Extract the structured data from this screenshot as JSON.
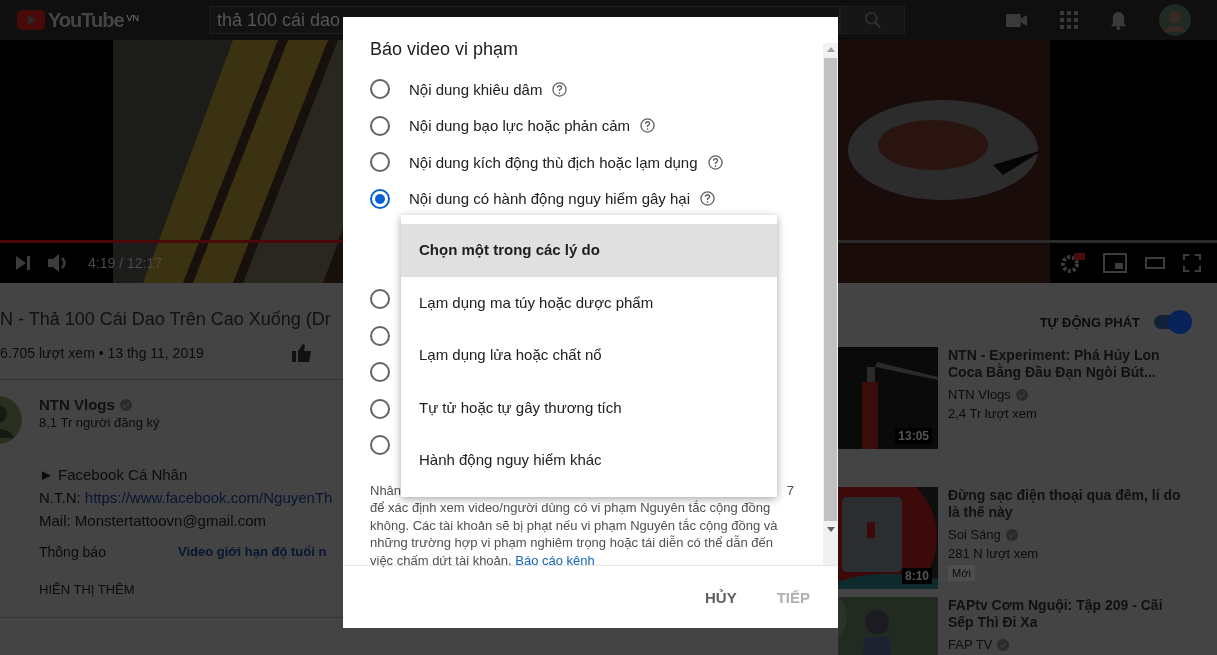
{
  "topbar": {
    "logo": "YouTube",
    "region": "VN",
    "search": {
      "value": "thả 100 cái dao"
    }
  },
  "player": {
    "time": "4:19 / 12:17",
    "progress": {
      "level": 0.35
    }
  },
  "video": {
    "title": "N - Thả 100 Cái Dao Trên Cao Xuống (Dr",
    "meta": "6.705 lượt xem • 13 thg 11, 2019"
  },
  "channel": {
    "name": "NTN Vlogs",
    "verified": true,
    "subscribers": "8,1 Tr người đăng ký"
  },
  "description": {
    "lines": [
      {
        "text": "► Facebook Cá Nhân"
      },
      {
        "text": "N.T.N: ",
        "link": "https://www.facebook.com/NguyenTh"
      },
      {
        "text": "Mail: Monstertattoovn@gmail.com"
      }
    ],
    "category": {
      "label": "Thông báo",
      "value": "Video giới hạn độ tuổi n"
    },
    "show_more": "HIỂN THỊ THÊM"
  },
  "autoplay": {
    "label": "TỰ ĐỘNG PHÁT",
    "on": true
  },
  "up_next": [
    {
      "title": "NTN - Experiment: Phá Hủy Lon Coca Bằng Đầu Đạn Ngòi Bút...",
      "channel": "NTN Vlogs",
      "verified": true,
      "views": "2,4 Tr lượt xem",
      "duration": "13:05"
    },
    {
      "title": "Đừng sạc điện thoại qua đêm, lí do là thế này",
      "channel": "Soi Sáng",
      "verified": true,
      "views": "281 N lượt xem",
      "badge": "Mới",
      "duration": "8:10"
    },
    {
      "title": "FAPtv Cơm Nguội: Tập 209 - Cãi Sếp Thì Đi Xa",
      "channel": "FAP TV",
      "verified": true
    }
  ],
  "dialog": {
    "title": "Báo video vi phạm",
    "options": [
      {
        "label": "Nội dung khiêu dâm",
        "selected": false
      },
      {
        "label": "Nội dung bạo lực hoặc phản cảm",
        "selected": false
      },
      {
        "label": "Nội dung kích động thù địch hoặc lạm dụng",
        "selected": false
      },
      {
        "label": "Nội dung có hành động nguy hiểm gây hại",
        "selected": true
      },
      {
        "selected": false
      },
      {
        "selected": false
      },
      {
        "selected": false
      },
      {
        "selected": false
      },
      {
        "selected": false
      }
    ],
    "reason_menu": {
      "items": [
        {
          "label": "Chọn một trong các lý do",
          "selected": true
        },
        {
          "label": "Lạm dụng ma túy hoặc dược phẩm",
          "selected": false
        },
        {
          "label": "Lạm dụng lửa hoặc chất nổ",
          "selected": false
        },
        {
          "label": "Tự tử hoặc tự gây thương tích",
          "selected": false
        },
        {
          "label": "Hành động nguy hiểm khác",
          "selected": false
        }
      ]
    },
    "notice": {
      "start": "Nhân",
      "end": "7",
      "text": "để xác định xem video/người dùng có vi phạm Nguyên tắc cộng đồng không. Các tài khoản sẽ bị phạt nếu vi phạm Nguyên tắc cộng đồng và những trường hợp vi phạm nghiêm trọng hoặc tái diễn có thể dẫn đến việc chấm dứt tài khoản.",
      "link": "Báo cáo kênh"
    },
    "buttons": [
      {
        "label": "HỦY",
        "disabled": false
      },
      {
        "label": "TIẾP",
        "disabled": true
      }
    ]
  }
}
